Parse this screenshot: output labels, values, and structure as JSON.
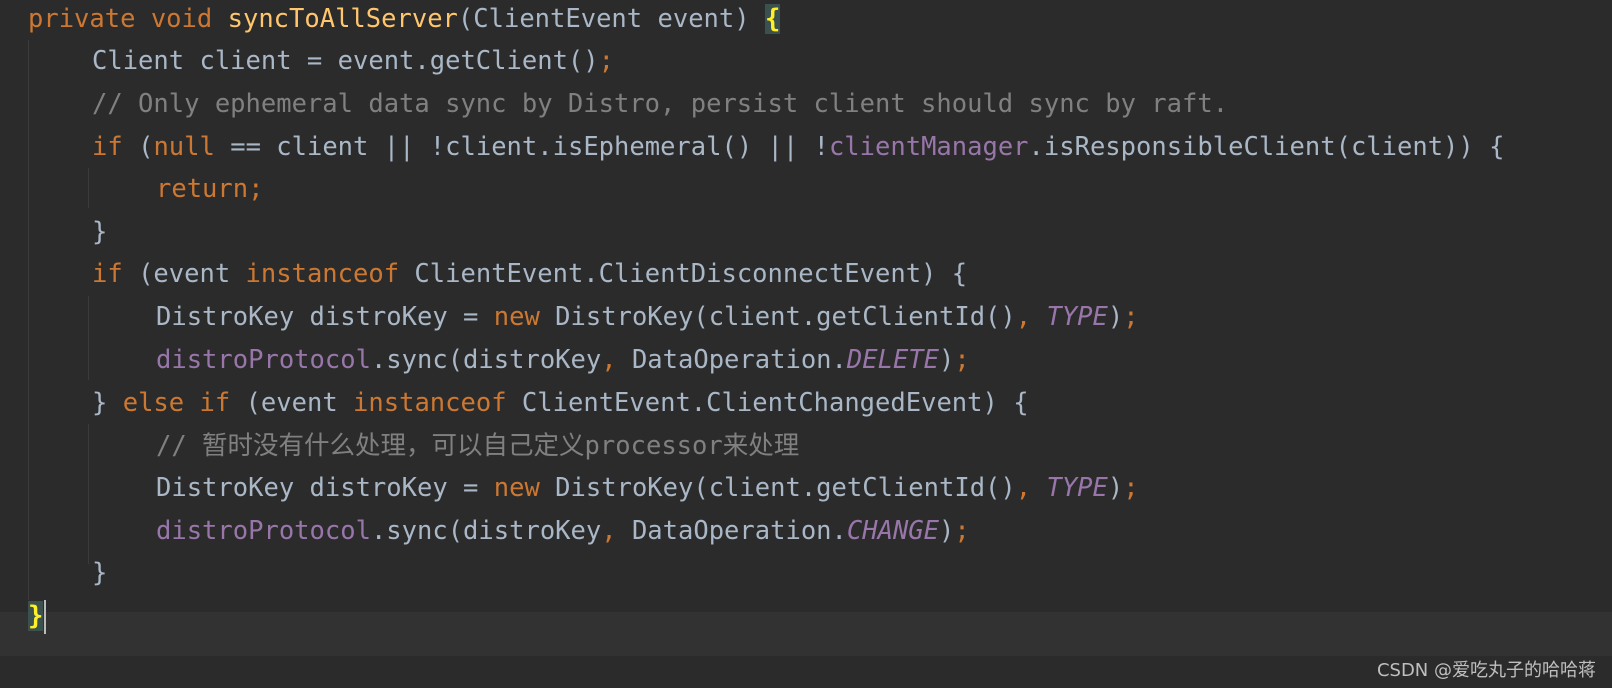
{
  "code": {
    "l1": {
      "kw_private": "private",
      "kw_void": "void",
      "method": "syncToAllServer",
      "params": "(ClientEvent event) ",
      "brace": "{"
    },
    "l2": {
      "text": "Client client = event.getClient()",
      "semi": ";"
    },
    "l3": {
      "comment": "// Only ephemeral data sync by Distro, persist client should sync by raft."
    },
    "l4": {
      "kw_if": "if",
      "p1": " (",
      "kw_null": "null",
      "p2": " == client || !client.isEphemeral() || !",
      "field": "clientManager",
      "p3": ".isResponsibleClient(client)) {"
    },
    "l5": {
      "kw_return": "return;"
    },
    "l6": {
      "text": "}"
    },
    "l7": {
      "kw_if": "if",
      "p1": " (event ",
      "kw_instanceof": "instanceof",
      "p2": " ClientEvent.ClientDisconnectEvent) {"
    },
    "l8": {
      "p1": "DistroKey distroKey = ",
      "kw_new": "new",
      "p2": " DistroKey(client.getClientId()",
      "comma": ",",
      "const": "TYPE",
      "p3": ")",
      "semi": ";"
    },
    "l9": {
      "field": "distroProtocol",
      "p1": ".sync(distroKey",
      "comma": ",",
      "p2": " DataOperation.",
      "const": "DELETE",
      "p3": ")",
      "semi": ";"
    },
    "l10": {
      "p1": "} ",
      "kw_else": "else",
      "kw_if": "if",
      "p2": " (event ",
      "kw_instanceof": "instanceof",
      "p3": " ClientEvent.ClientChangedEvent) {"
    },
    "l11": {
      "comment": "// 暂时没有什么处理，可以自己定义processor来处理"
    },
    "l12": {
      "p1": "DistroKey distroKey = ",
      "kw_new": "new",
      "p2": " DistroKey(client.getClientId()",
      "comma": ",",
      "const": "TYPE",
      "p3": ")",
      "semi": ";"
    },
    "l13": {
      "field": "distroProtocol",
      "p1": ".sync(distroKey",
      "comma": ",",
      "p2": " DataOperation.",
      "const": "CHANGE",
      "p3": ")",
      "semi": ";"
    },
    "l14": {
      "text": "}"
    },
    "l15": {
      "brace": "}"
    }
  },
  "watermark": "CSDN @爱吃丸子的哈哈蒋",
  "colors": {
    "background": "#2b2b2b",
    "keyword": "#cc7832",
    "method": "#ffc66d",
    "field": "#9876aa",
    "comment": "#808080",
    "text": "#a9b7c6",
    "brace_match": "#ffef28"
  }
}
